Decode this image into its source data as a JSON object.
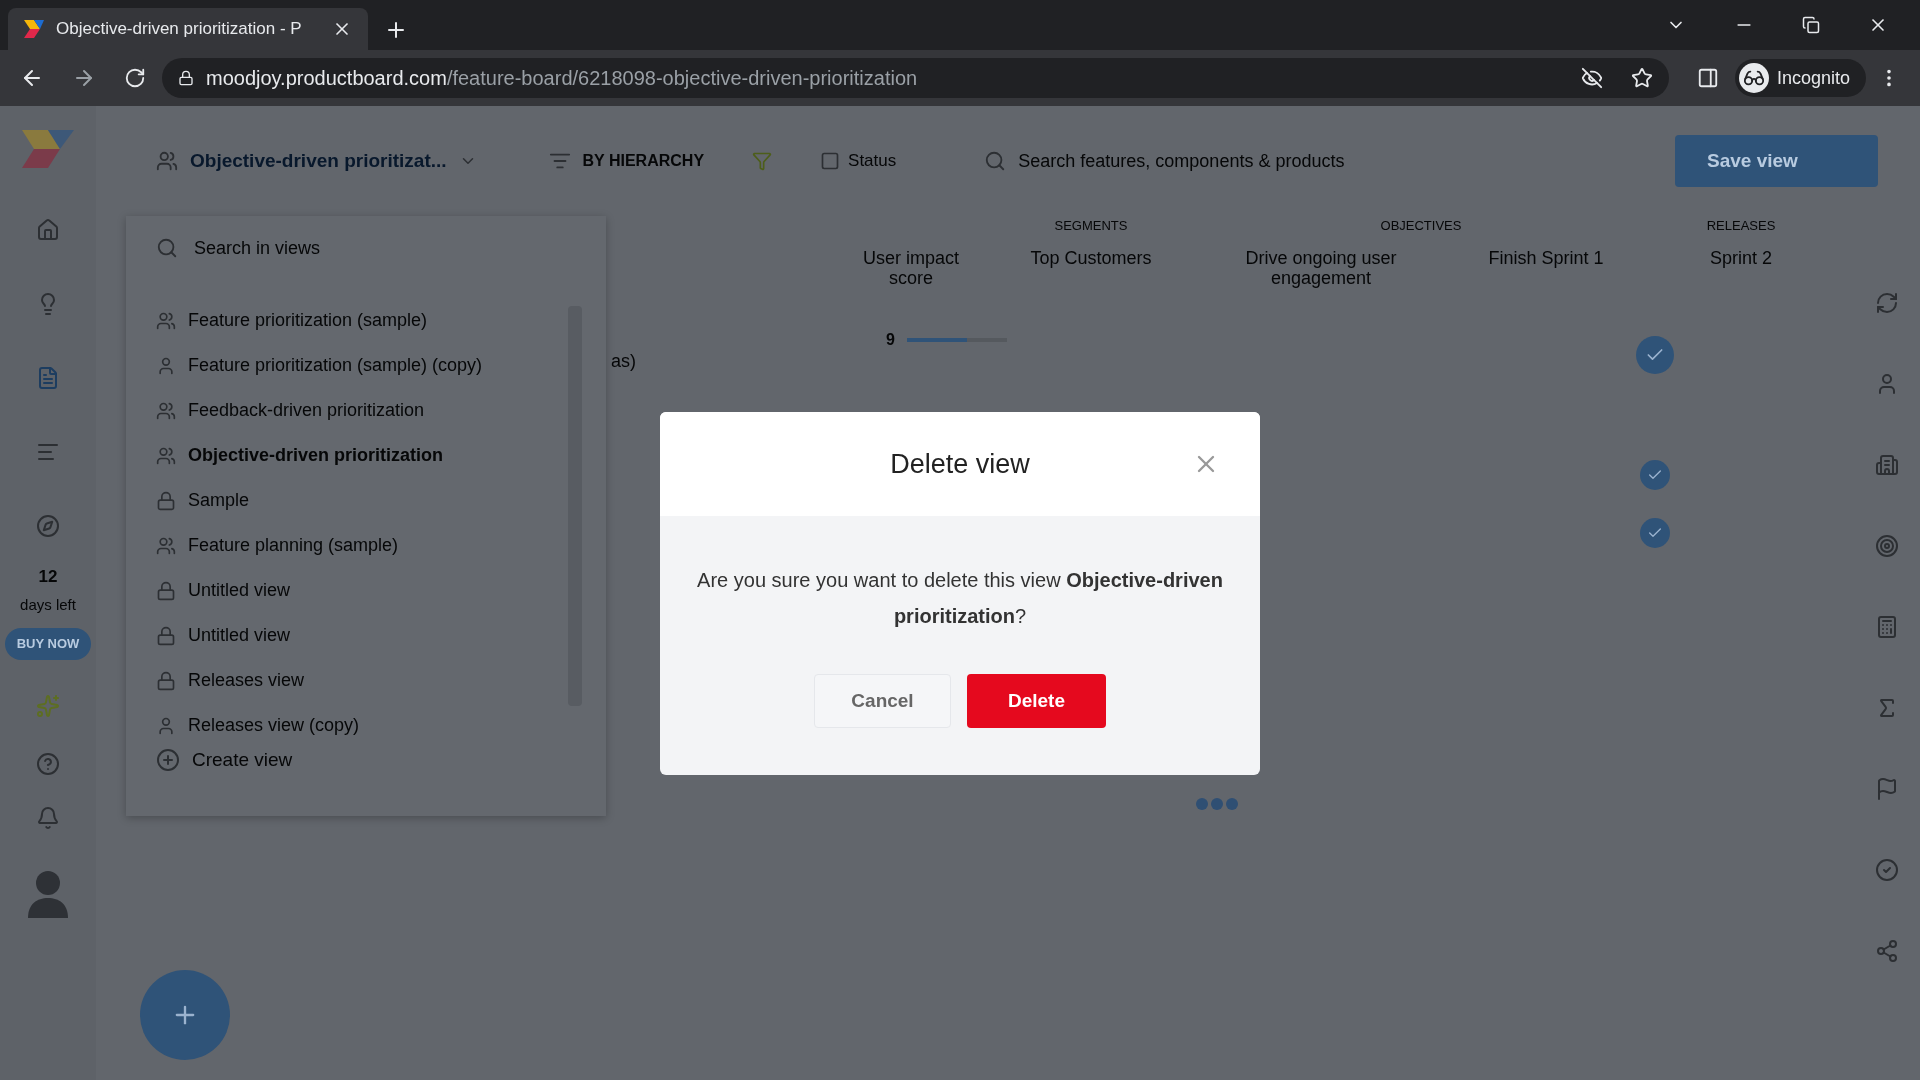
{
  "browser": {
    "tab_title": "Objective-driven prioritization - P",
    "url_host": "moodjoy.productboard.com",
    "url_path": "/feature-board/6218098-objective-driven-prioritization",
    "profile": "Incognito"
  },
  "topbar": {
    "view_name": "Objective-driven prioritizat...",
    "grouping": "BY HIERARCHY",
    "status": "Status",
    "search_placeholder": "Search features, components & products",
    "save": "Save view"
  },
  "nav": {
    "trial_days": "12",
    "trial_label": "days left",
    "buy": "BUY NOW"
  },
  "views_panel": {
    "search_placeholder": "Search in views",
    "create": "Create view",
    "views": [
      {
        "label": "Feature prioritization (sample)",
        "kind": "shared",
        "selected": false
      },
      {
        "label": "Feature prioritization (sample) (copy)",
        "kind": "personal",
        "selected": false
      },
      {
        "label": "Feedback-driven prioritization",
        "kind": "shared",
        "selected": false
      },
      {
        "label": "Objective-driven prioritization",
        "kind": "shared",
        "selected": true
      },
      {
        "label": "Sample",
        "kind": "private",
        "selected": false
      },
      {
        "label": "Feature planning (sample)",
        "kind": "shared",
        "selected": false
      },
      {
        "label": "Untitled view",
        "kind": "private",
        "selected": false
      },
      {
        "label": "Untitled view",
        "kind": "private",
        "selected": false
      },
      {
        "label": "Releases view",
        "kind": "private",
        "selected": false
      },
      {
        "label": "Releases view (copy)",
        "kind": "personal",
        "selected": false
      }
    ]
  },
  "board": {
    "fragment": "as)",
    "group_headers": [
      "SEGMENTS",
      "OBJECTIVES",
      "RELEASES"
    ],
    "columns": [
      "User impact score",
      "Top Customers",
      "Drive ongoing user engagement",
      "Finish Sprint 1",
      "Sprint 2"
    ],
    "first_row": {
      "score": "9",
      "level": 0.6
    }
  },
  "dialog": {
    "title": "Delete view",
    "message": "Are you sure you want to delete this view **Objective-driven prioritization**?",
    "buttons": [
      {
        "label": "Cancel",
        "kind": "secondary"
      },
      {
        "label": "Delete",
        "kind": "danger"
      }
    ]
  }
}
